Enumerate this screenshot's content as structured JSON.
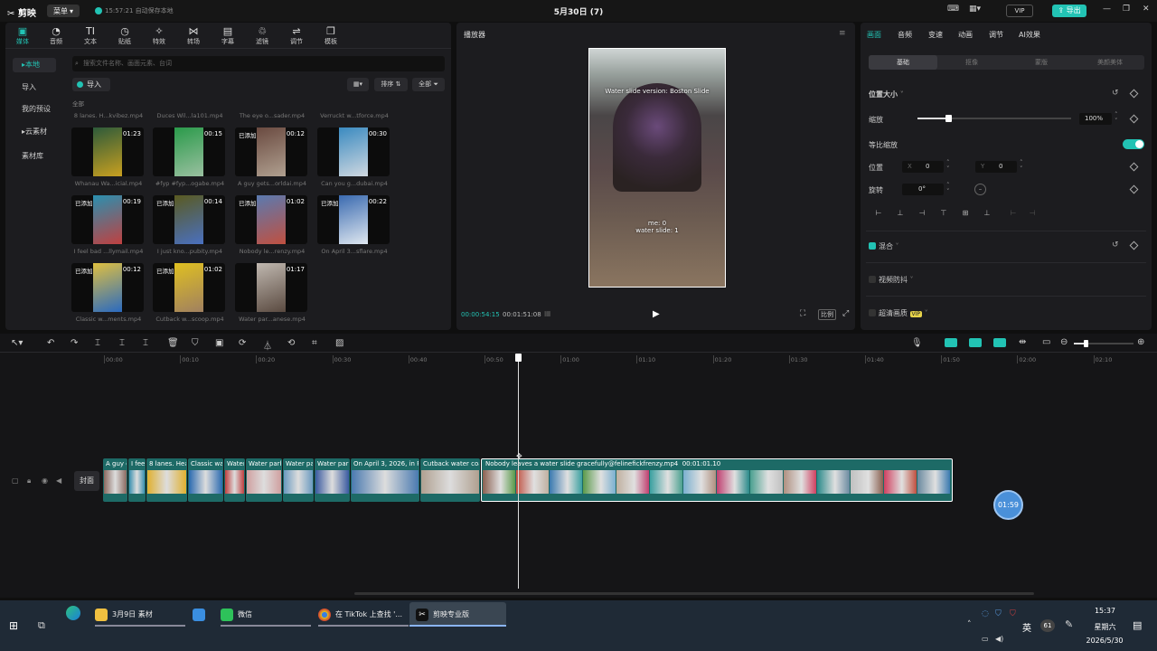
{
  "app": {
    "logo": "剪映",
    "menu": "菜单",
    "autosave": "15:57:21 自动保存本地",
    "title": "5月30日 (7)",
    "vip": "VIP",
    "export": "导出"
  },
  "media_tabs": [
    {
      "label": "媒体",
      "icon": "▣"
    },
    {
      "label": "音频",
      "icon": "◔"
    },
    {
      "label": "文本",
      "icon": "TI"
    },
    {
      "label": "贴纸",
      "icon": "◷"
    },
    {
      "label": "特效",
      "icon": "✧"
    },
    {
      "label": "转场",
      "icon": "⋈"
    },
    {
      "label": "字幕",
      "icon": "▤"
    },
    {
      "label": "滤镜",
      "icon": "♲"
    },
    {
      "label": "调节",
      "icon": "⇌"
    },
    {
      "label": "模板",
      "icon": "❐"
    }
  ],
  "side_nav": [
    "▸本地",
    "导入",
    "我的预设",
    "▸云素材",
    "素材库"
  ],
  "search_placeholder": "搜索文件名称、画面元素、台词",
  "import": "导入",
  "sort": "排序",
  "all": "全部",
  "all_label": "全部",
  "top_row": [
    "8 lanes. H...kvibez.mp4",
    "Duces Wil...la101.mp4",
    "The eye o...sader.mp4",
    "Verruckt w...tforce.mp4"
  ],
  "media": [
    {
      "name": "Whanau Wa...icial.mp4",
      "dur": "01:23",
      "added": "",
      "c1": "#2d5a3a",
      "c2": "#c9a020"
    },
    {
      "name": "#fyp #fyp...ogabe.mp4",
      "dur": "00:15",
      "added": "",
      "c1": "#2a9a4a",
      "c2": "#9ac0a0"
    },
    {
      "name": "A guy gets...orldai.mp4",
      "dur": "00:12",
      "added": "已添加",
      "c1": "#6a4a40",
      "c2": "#b0a090"
    },
    {
      "name": "Can you g...dubai.mp4",
      "dur": "00:30",
      "added": "",
      "c1": "#3a8ac0",
      "c2": "#d0d8e0"
    },
    {
      "name": "I feel bad ...llymail.mp4",
      "dur": "00:19",
      "added": "已添加",
      "c1": "#2a90b0",
      "c2": "#c04040"
    },
    {
      "name": "I just kno...pubity.mp4",
      "dur": "00:14",
      "added": "已添加",
      "c1": "#5a5a20",
      "c2": "#4a70c0"
    },
    {
      "name": "Nobody le...renzy.mp4",
      "dur": "01:02",
      "added": "已添加",
      "c1": "#5a7ab0",
      "c2": "#c05040"
    },
    {
      "name": "On April 3...sflare.mp4",
      "dur": "00:22",
      "added": "已添加",
      "c1": "#3a6ab0",
      "c2": "#e0e8f0"
    },
    {
      "name": "Classic w...ments.mp4",
      "dur": "00:12",
      "added": "已添加",
      "c1": "#e0c040",
      "c2": "#2a6ac0"
    },
    {
      "name": "Cutback w...scoop.mp4",
      "dur": "01:02",
      "added": "已添加",
      "c1": "#e0c020",
      "c2": "#a08060"
    },
    {
      "name": "Water par...anese.mp4",
      "dur": "01:17",
      "added": "",
      "c1": "#c0b8b0",
      "c2": "#5a4a40"
    }
  ],
  "player": {
    "title": "播放器",
    "overlay_top": "Water slide version: Boston Slide",
    "overlay_mid1": "me: 0",
    "overlay_mid2": "water slide: 1",
    "time_current": "00:00:54:15",
    "time_total": "00:01:51:08",
    "ratio": "比例"
  },
  "props": {
    "tabs": [
      "画面",
      "音频",
      "变速",
      "动画",
      "调节",
      "AI效果"
    ],
    "subtabs": [
      "基础",
      "抠像",
      "蒙版",
      "美颜美体"
    ],
    "section_size": "位置大小",
    "scale_label": "缩放",
    "scale_value": "100%",
    "uniform_label": "等比缩放",
    "pos_label": "位置",
    "x_label": "X",
    "x_value": "0",
    "y_label": "Y",
    "y_value": "0",
    "rot_label": "旋转",
    "rot_value": "0°",
    "blend": "混合",
    "stabilize": "视频防抖",
    "enhance": "超清画质",
    "enhance_badge": "VIP"
  },
  "align_icons": [
    "⊢",
    "⊥",
    "⊣",
    "⊤",
    "⊞",
    "⊥",
    "⊢",
    "⊣"
  ],
  "ruler": [
    "00:00",
    "00:10",
    "00:20",
    "00:30",
    "00:40",
    "00:50",
    "01:00",
    "01:10",
    "01:20",
    "01:30",
    "01:40",
    "01:50",
    "02:00",
    "02:10"
  ],
  "track": {
    "cover": "封面",
    "playhead": "01:59"
  },
  "clips": [
    {
      "name": "A guy g",
      "c": "#8a6a60"
    },
    {
      "name": "I fee",
      "c": "#3a90b0"
    },
    {
      "name": "8 lanes. Hea",
      "c": "#e0b030"
    },
    {
      "name": "Classic wat",
      "c": "#2a6ab0"
    },
    {
      "name": "Water",
      "c": "#c04040"
    },
    {
      "name": "Water park",
      "c": "#d0a0a0"
    },
    {
      "name": "Water pa",
      "c": "#6a9ac0"
    },
    {
      "name": "Water park",
      "c": "#3a5aa0"
    },
    {
      "name": "On April 3, 2026, in Par",
      "c": "#4a7ab0"
    },
    {
      "name": "Cutback water coas",
      "c": "#b0a090"
    }
  ],
  "selected_clip": {
    "name": "Nobody leaves a water slide gracefully@felinefickfrenzy.mp4",
    "dur": "00:01:01.10"
  },
  "taskbar": {
    "apps": [
      "3月9日 素材",
      "",
      "微信",
      "在 TikTok 上查找 '...",
      "剪映专业版"
    ],
    "ime": "英",
    "badge": "61",
    "time": "15:37",
    "weekday": "星期六",
    "date": "2026/5/30"
  }
}
